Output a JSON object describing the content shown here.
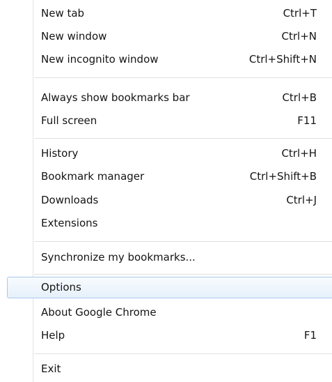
{
  "menu": {
    "items": [
      {
        "label": "New tab",
        "shortcut": "Ctrl+T"
      },
      {
        "label": "New window",
        "shortcut": "Ctrl+N"
      },
      {
        "label": "New incognito window",
        "shortcut": "Ctrl+Shift+N"
      },
      {
        "label": "Always show bookmarks bar",
        "shortcut": "Ctrl+B"
      },
      {
        "label": "Full screen",
        "shortcut": "F11"
      },
      {
        "label": "History",
        "shortcut": "Ctrl+H"
      },
      {
        "label": "Bookmark manager",
        "shortcut": "Ctrl+Shift+B"
      },
      {
        "label": "Downloads",
        "shortcut": "Ctrl+J"
      },
      {
        "label": "Extensions",
        "shortcut": ""
      },
      {
        "label": "Synchronize my bookmarks...",
        "shortcut": ""
      },
      {
        "label": "Options",
        "shortcut": ""
      },
      {
        "label": "About Google Chrome",
        "shortcut": ""
      },
      {
        "label": "Help",
        "shortcut": "F1"
      },
      {
        "label": "Exit",
        "shortcut": ""
      }
    ],
    "highlighted_item": "Options",
    "colors": {
      "highlight_border": "#a8c8ec",
      "highlight_fill": "#e6f0fa",
      "text": "#141414",
      "separator": "#e0e0e0"
    }
  }
}
